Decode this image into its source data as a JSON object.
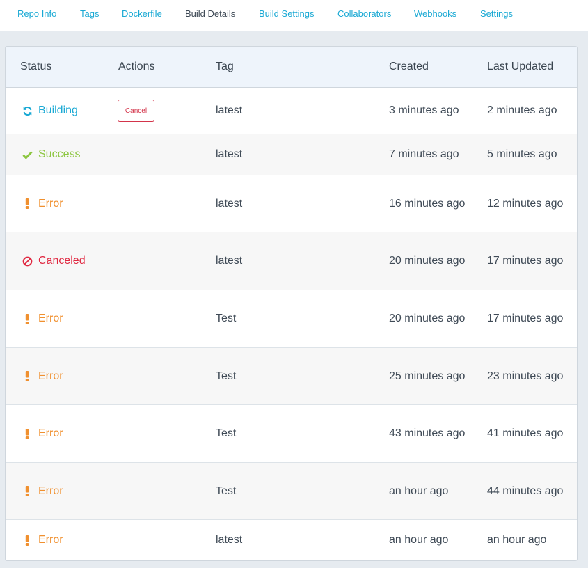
{
  "tabs": [
    {
      "label": "Repo Info",
      "active": false
    },
    {
      "label": "Tags",
      "active": false
    },
    {
      "label": "Dockerfile",
      "active": false
    },
    {
      "label": "Build Details",
      "active": true
    },
    {
      "label": "Build Settings",
      "active": false
    },
    {
      "label": "Collaborators",
      "active": false
    },
    {
      "label": "Webhooks",
      "active": false
    },
    {
      "label": "Settings",
      "active": false
    }
  ],
  "table": {
    "headers": {
      "status": "Status",
      "actions": "Actions",
      "tag": "Tag",
      "created": "Created",
      "updated": "Last Updated"
    },
    "cancel_label": "Cancel",
    "rows": [
      {
        "status": "Building",
        "icon": "refresh-icon",
        "tag": "latest",
        "created": "3 minutes ago",
        "updated": "2 minutes ago"
      },
      {
        "status": "Success",
        "icon": "check-icon",
        "tag": "latest",
        "created": "7 minutes ago",
        "updated": "5 minutes ago"
      },
      {
        "status": "Error",
        "icon": "exclamation-icon",
        "tag": "latest",
        "created": "16 minutes ago",
        "updated": "12 minutes ago"
      },
      {
        "status": "Canceled",
        "icon": "ban-icon",
        "tag": "latest",
        "created": "20 minutes ago",
        "updated": "17 minutes ago"
      },
      {
        "status": "Error",
        "icon": "exclamation-icon",
        "tag": "Test",
        "created": "20 minutes ago",
        "updated": "17 minutes ago"
      },
      {
        "status": "Error",
        "icon": "exclamation-icon",
        "tag": "Test",
        "created": "25 minutes ago",
        "updated": "23 minutes ago"
      },
      {
        "status": "Error",
        "icon": "exclamation-icon",
        "tag": "Test",
        "created": "43 minutes ago",
        "updated": "41 minutes ago"
      },
      {
        "status": "Error",
        "icon": "exclamation-icon",
        "tag": "Test",
        "created": "an hour ago",
        "updated": "44 minutes ago"
      },
      {
        "status": "Error",
        "icon": "exclamation-icon",
        "tag": "latest",
        "created": "an hour ago",
        "updated": "an hour ago"
      }
    ]
  },
  "colors": {
    "accent": "#1aa9d4",
    "building": "#1aa9d4",
    "success": "#8cc63f",
    "error": "#f0902f",
    "canceled": "#e0263f"
  }
}
